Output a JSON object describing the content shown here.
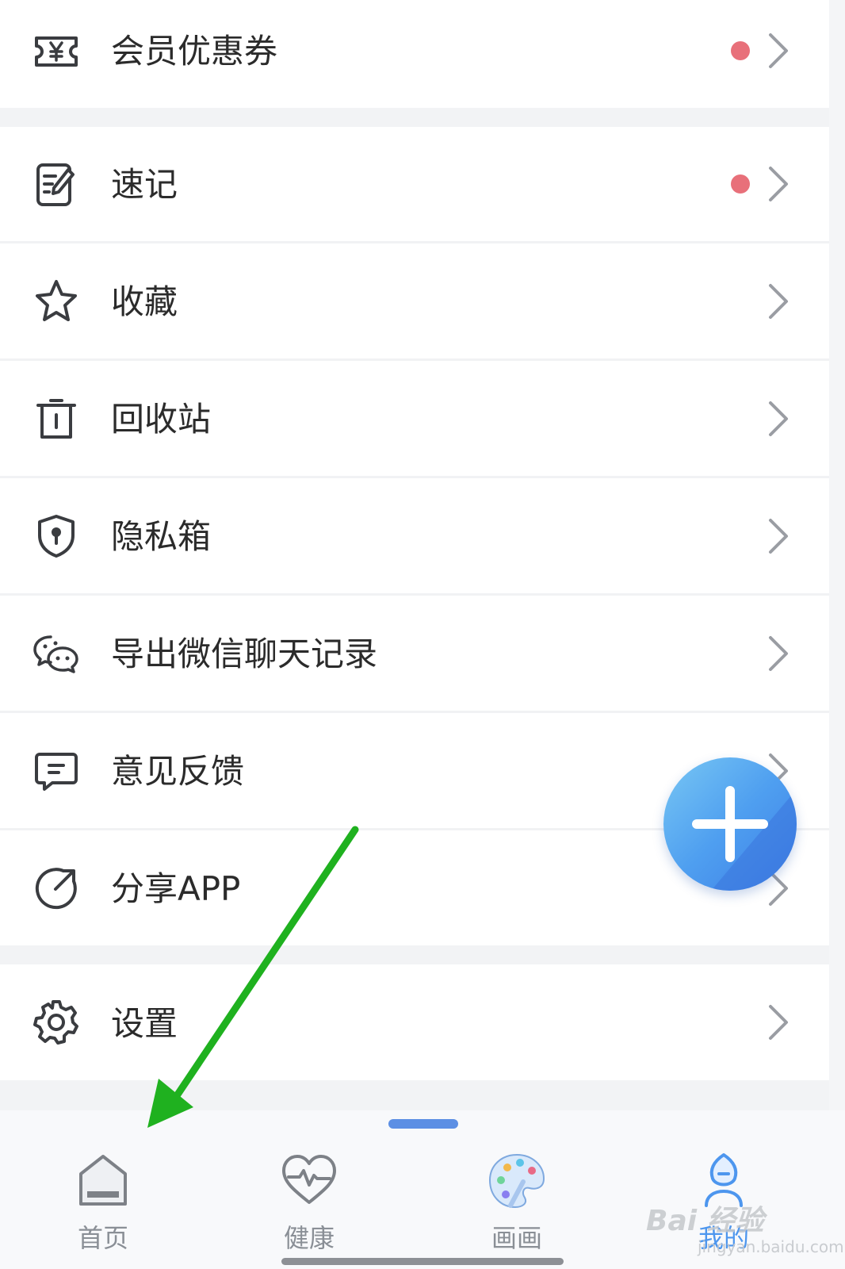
{
  "menu_groups": [
    {
      "items": [
        {
          "label": "会员优惠券",
          "icon": "coupon-icon",
          "badge": true
        }
      ]
    },
    {
      "items": [
        {
          "label": "速记",
          "icon": "memo-icon",
          "badge": true
        },
        {
          "label": "收藏",
          "icon": "star-icon",
          "badge": false
        },
        {
          "label": "回收站",
          "icon": "trash-icon",
          "badge": false
        },
        {
          "label": "隐私箱",
          "icon": "shield-lock-icon",
          "badge": false
        },
        {
          "label": "导出微信聊天记录",
          "icon": "wechat-icon",
          "badge": false
        },
        {
          "label": "意见反馈",
          "icon": "feedback-icon",
          "badge": false
        },
        {
          "label": "分享APP",
          "icon": "share-icon",
          "badge": false
        }
      ]
    },
    {
      "items": [
        {
          "label": "设置",
          "icon": "gear-icon",
          "badge": false
        }
      ]
    }
  ],
  "fab": {
    "icon": "plus-icon"
  },
  "tabbar": {
    "tabs": [
      {
        "label": "首页",
        "icon": "home-icon"
      },
      {
        "label": "健康",
        "icon": "heart-pulse-icon"
      },
      {
        "label": "画画",
        "icon": "palette-icon"
      },
      {
        "label": "我的",
        "icon": "user-icon"
      }
    ]
  },
  "watermark": {
    "text": "Bai 经验",
    "sub": "jingyan.baidu.com"
  },
  "colors": {
    "badge": "#e8707a",
    "arrow": "#1fb11f",
    "icon": "#3a3c40",
    "chevron": "#9a9da3",
    "accent": "#4d96ee"
  }
}
